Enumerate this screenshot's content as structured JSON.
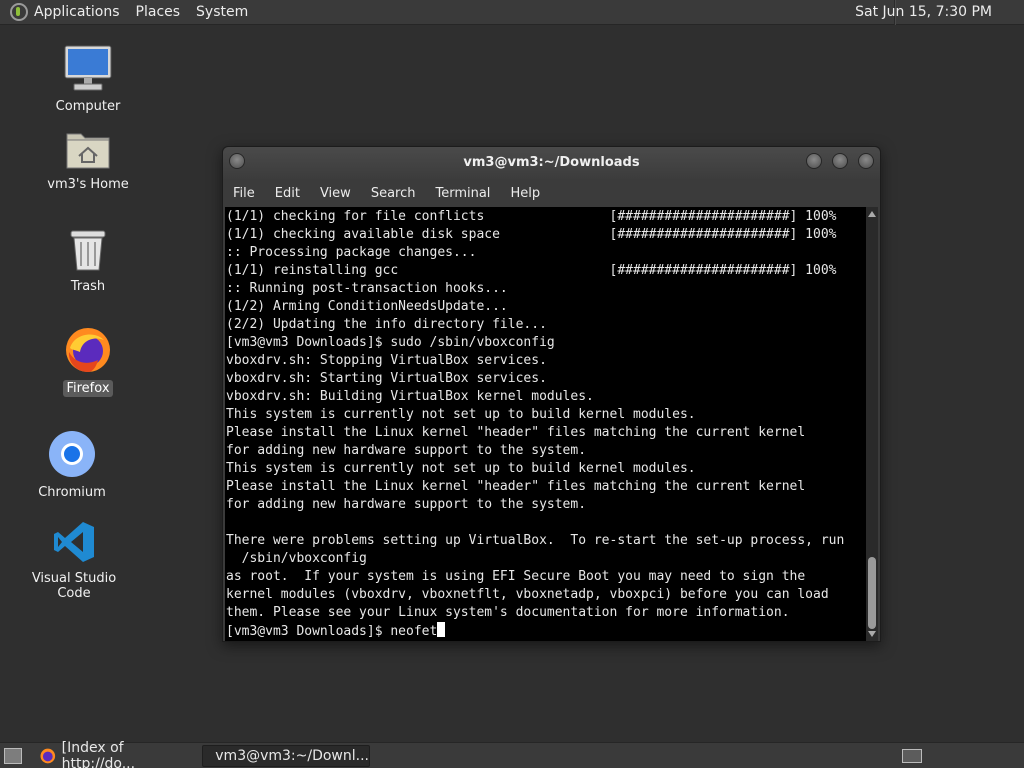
{
  "top_panel": {
    "menus": [
      "Applications",
      "Places",
      "System"
    ],
    "clock": "Sat Jun 15,  7:30 PM"
  },
  "desktop_icons": [
    {
      "label": "Computer",
      "icon": "computer-icon"
    },
    {
      "label": "vm3's Home",
      "icon": "home-folder-icon"
    },
    {
      "label": "Trash",
      "icon": "trash-icon"
    },
    {
      "label": "Firefox",
      "icon": "firefox-icon"
    },
    {
      "label": "Chromium",
      "icon": "chromium-icon"
    },
    {
      "label": "Visual Studio Code",
      "icon": "vscode-icon"
    }
  ],
  "terminal": {
    "title": "vm3@vm3:~/Downloads",
    "menu": [
      "File",
      "Edit",
      "View",
      "Search",
      "Terminal",
      "Help"
    ],
    "lines": [
      "(1/1) checking for file conflicts                [######################] 100%",
      "(1/1) checking available disk space              [######################] 100%",
      ":: Processing package changes...",
      "(1/1) reinstalling gcc                           [######################] 100%",
      ":: Running post-transaction hooks...",
      "(1/2) Arming ConditionNeedsUpdate...",
      "(2/2) Updating the info directory file...",
      "[vm3@vm3 Downloads]$ sudo /sbin/vboxconfig",
      "vboxdrv.sh: Stopping VirtualBox services.",
      "vboxdrv.sh: Starting VirtualBox services.",
      "vboxdrv.sh: Building VirtualBox kernel modules.",
      "This system is currently not set up to build kernel modules.",
      "Please install the Linux kernel \"header\" files matching the current kernel",
      "for adding new hardware support to the system.",
      "This system is currently not set up to build kernel modules.",
      "Please install the Linux kernel \"header\" files matching the current kernel",
      "for adding new hardware support to the system.",
      "",
      "There were problems setting up VirtualBox.  To re-start the set-up process, run",
      "  /sbin/vboxconfig",
      "as root.  If your system is using EFI Secure Boot you may need to sign the",
      "kernel modules (vboxdrv, vboxnetflt, vboxnetadp, vboxpci) before you can load",
      "them. Please see your Linux system's documentation for more information."
    ],
    "prompt_line": "[vm3@vm3 Downloads]$ neofet"
  },
  "taskbar": {
    "tasks": [
      {
        "label": "[Index of http://do...",
        "icon": "firefox-icon"
      },
      {
        "label": "vm3@vm3:~/Downl...",
        "icon": "terminal-icon"
      }
    ]
  },
  "colors": {
    "panel": "#3a3a3a",
    "desktop": "#2f2f2f",
    "terminal_bg": "#000000",
    "terminal_fg": "#e8e8e8",
    "accent": "#8fbf3a"
  }
}
